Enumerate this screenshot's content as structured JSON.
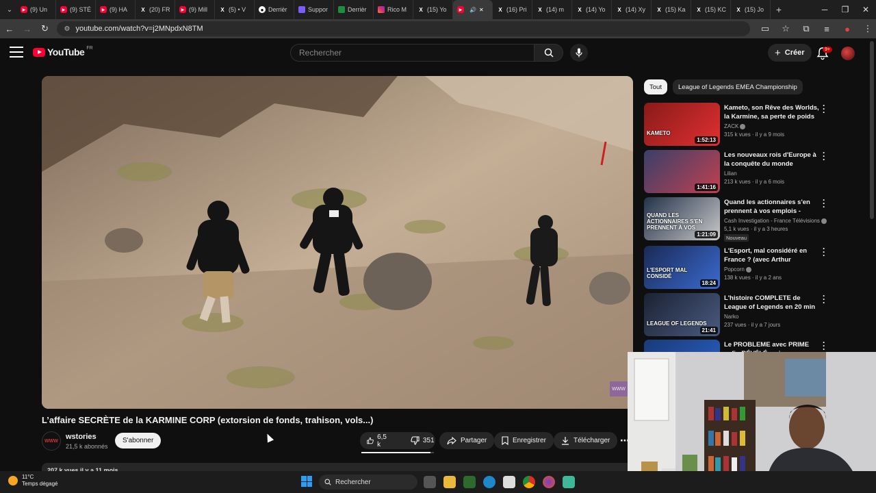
{
  "browser": {
    "tabs": [
      {
        "label": "(9) Un",
        "icon": "youtube-icon"
      },
      {
        "label": "(9) STÉ",
        "icon": "youtube-icon"
      },
      {
        "label": "(9) HA",
        "icon": "youtube-icon"
      },
      {
        "label": "(20) FR",
        "icon": "x-icon"
      },
      {
        "label": "(9) Mill",
        "icon": "youtube-icon"
      },
      {
        "label": "(5) • V",
        "icon": "x-icon"
      },
      {
        "label": "Derrièr",
        "icon": "github-icon"
      },
      {
        "label": "Suppor",
        "icon": "purple-icon"
      },
      {
        "label": "Derrièr",
        "icon": "sheet-icon"
      },
      {
        "label": "Rico M",
        "icon": "instagram-icon"
      },
      {
        "label": "(15) Yo",
        "icon": "x-icon"
      },
      {
        "label": "",
        "icon": "youtube-icon",
        "active": true
      },
      {
        "label": "(16) Pri",
        "icon": "x-icon"
      },
      {
        "label": "(14) m",
        "icon": "x-icon"
      },
      {
        "label": "(14) Yo",
        "icon": "x-icon"
      },
      {
        "label": "(14) Xy",
        "icon": "x-icon"
      },
      {
        "label": "(15) Ka",
        "icon": "x-icon"
      },
      {
        "label": "(15) KC",
        "icon": "x-icon"
      },
      {
        "label": "(15) Jo",
        "icon": "x-icon"
      }
    ],
    "url": "youtube.com/watch?v=j2MNpdxN8TM"
  },
  "header": {
    "logo_text": "YouTube",
    "region": "FR",
    "search_placeholder": "Rechercher",
    "create_label": "Créer",
    "notif_count": "9+"
  },
  "video": {
    "title": "L’affaire SECRÈTE de la KARMINE CORP (extorsion de fonds, trahison, vols...)",
    "channel": "wstories",
    "subscribers": "21,5 k abonnés",
    "subscribe_label": "S'abonner",
    "likes": "6,5 k",
    "dislikes": "351",
    "share_label": "Partager",
    "save_label": "Enregistrer",
    "download_label": "Télécharger",
    "views_line": "207 k vues  il y a 11 mois",
    "watermark": "WWW",
    "channel_avatar_text": "WWW"
  },
  "chips": [
    {
      "label": "Tout",
      "active": true
    },
    {
      "label": "League of Legends EMEA Championship",
      "active": false
    }
  ],
  "related": [
    {
      "title": "Kameto, son Rêve des Worlds, la Karmine, sa perte de poids -...",
      "channel": "ZACK",
      "verified": true,
      "meta": "315 k vues · il y a 9 mois",
      "duration": "1:52:13",
      "thumb_text": "KAMETO",
      "thumb_colors": [
        "#8a1a1a",
        "#e03030"
      ],
      "badge": ""
    },
    {
      "title": "Les nouveaux rois d'Europe à la conquête du monde",
      "channel": "Lilian",
      "verified": false,
      "meta": "213 k vues · il y a 6 mois",
      "duration": "1:41:16",
      "thumb_text": "",
      "thumb_colors": [
        "#3a3f6a",
        "#c04050"
      ],
      "badge": ""
    },
    {
      "title": "Quand les actionnaires s'en prennent à vos emplois - Cash...",
      "channel": "Cash Investigation - France Télévisions",
      "verified": true,
      "meta": "5,1 k vues · il y a 3 heures",
      "duration": "1:21:09",
      "thumb_text": "QUAND LES ACTIONNAIRES S'EN PRENNENT À VOS",
      "thumb_colors": [
        "#23324a",
        "#c9c9c9"
      ],
      "badge": "Nouveau"
    },
    {
      "title": "L'Esport, mal considéré en France ? (avec Arthur Perticoz,...",
      "channel": "Popcorn",
      "verified": true,
      "meta": "138 k vues · il y a 2 ans",
      "duration": "18:24",
      "thumb_text": "L'ESPORT MAL CONSIDÉ",
      "thumb_colors": [
        "#1a2a55",
        "#3b6ad0"
      ],
      "badge": ""
    },
    {
      "title": "L'histoire COMPLETE de League of Legends en 20 min",
      "channel": "Narko",
      "verified": false,
      "meta": "237 vues · il y a 7 jours",
      "duration": "21:41",
      "thumb_text": "LEAGUE OF LEGENDS",
      "thumb_colors": [
        "#1b2233",
        "#4a5a80"
      ],
      "badge": ""
    },
    {
      "title": "Le PROBLEME avec PRIME enfin RÉVÉLÉ mais",
      "channel": "",
      "verified": false,
      "meta": "",
      "duration": "",
      "thumb_text": "",
      "thumb_colors": [
        "#1a3a7a",
        "#2a60c0"
      ],
      "badge": ""
    }
  ],
  "taskbar": {
    "temperature": "11°C",
    "weather": "Temps dégagé",
    "search_label": "Rechercher"
  }
}
